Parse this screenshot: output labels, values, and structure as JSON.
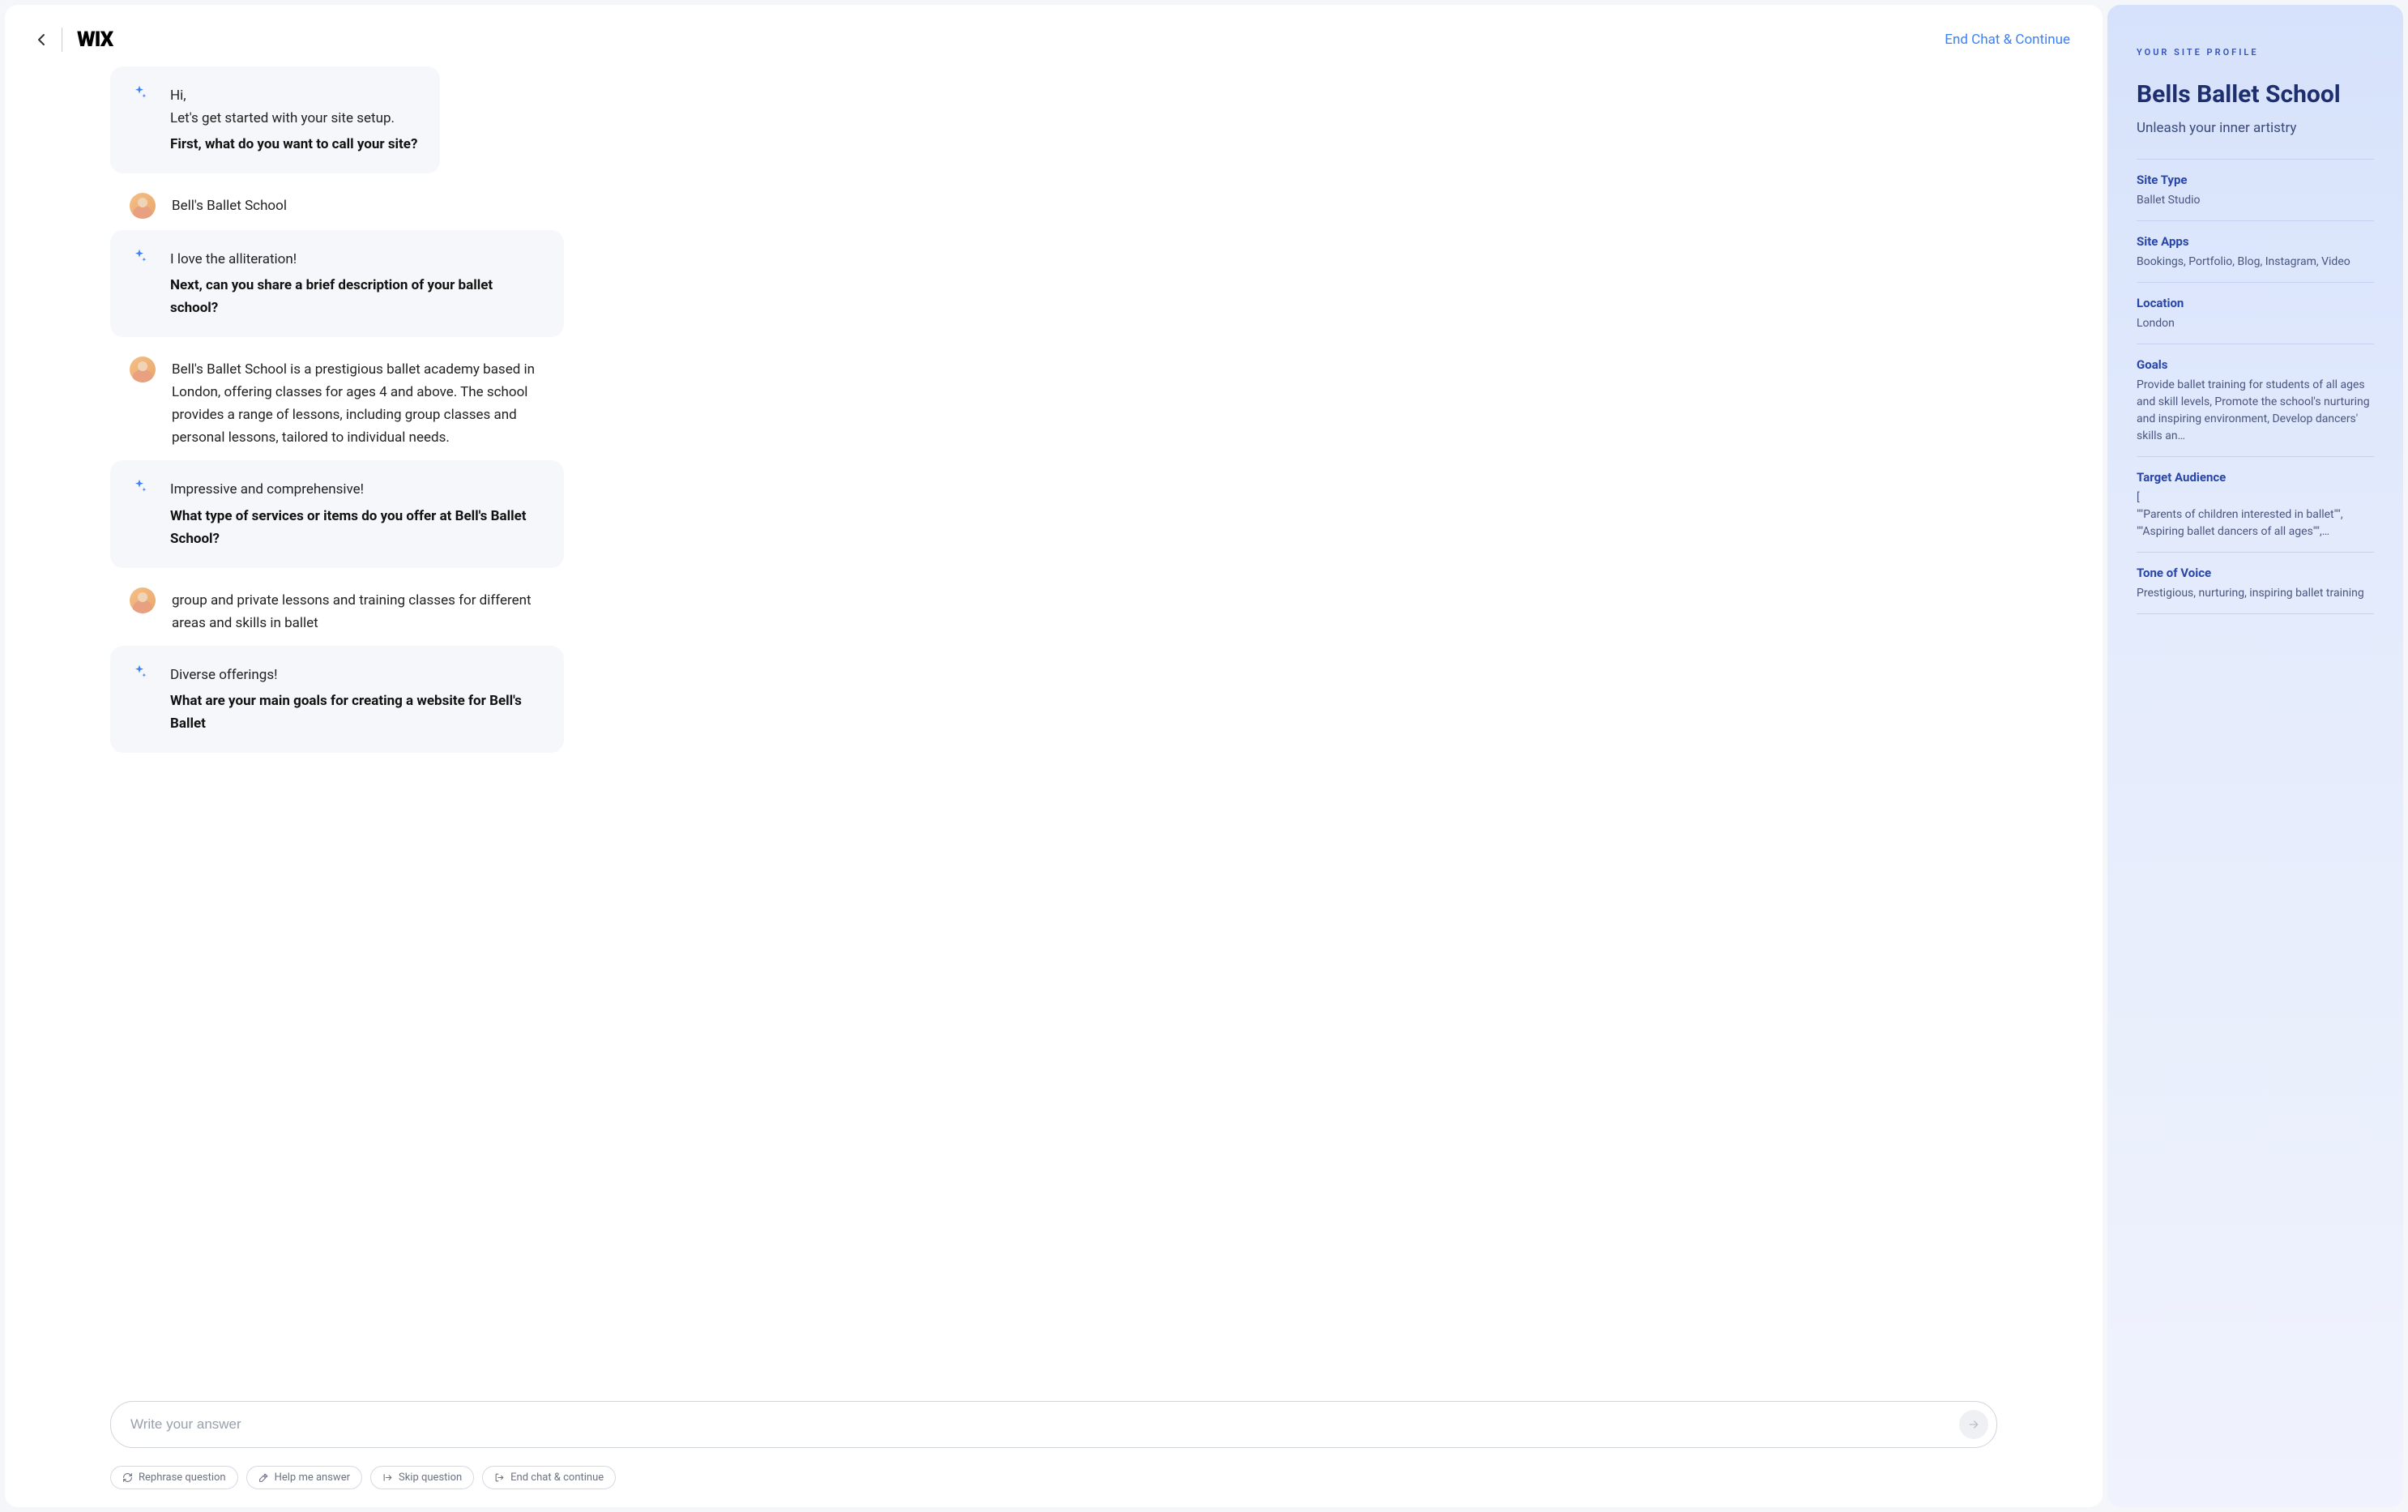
{
  "header": {
    "logo": "WIX",
    "end_chat_link": "End Chat & Continue"
  },
  "chat": [
    {
      "type": "ai",
      "lines": [
        "Hi,",
        "Let's get started with your site setup."
      ],
      "bold": "First, what do you want to call your site?"
    },
    {
      "type": "user",
      "text": "Bell's Ballet School"
    },
    {
      "type": "ai",
      "lines": [
        "I love the alliteration!"
      ],
      "bold": "Next, can you share a brief description of your ballet school?"
    },
    {
      "type": "user",
      "text": "Bell's Ballet School is a prestigious ballet academy based in London, offering classes for ages 4 and above. The school provides a range of lessons, including group classes and personal lessons, tailored to individual needs."
    },
    {
      "type": "ai",
      "lines": [
        "Impressive and comprehensive!"
      ],
      "bold": "What type of services or items do you offer at Bell's Ballet School?"
    },
    {
      "type": "user",
      "text": "group and private lessons and training classes for different areas and skills in ballet"
    },
    {
      "type": "ai",
      "lines": [
        "Diverse offerings!"
      ],
      "bold": "What are your main goals for creating a website for Bell's Ballet"
    }
  ],
  "input": {
    "placeholder": "Write your answer"
  },
  "pills": {
    "rephrase": "Rephrase question",
    "help": "Help me answer",
    "skip": "Skip question",
    "end": "End chat & continue"
  },
  "profile": {
    "label": "YOUR SITE PROFILE",
    "title": "Bells Ballet School",
    "tagline": "Unleash your inner artistry",
    "sections": [
      {
        "label": "Site Type",
        "value": "Ballet Studio"
      },
      {
        "label": "Site Apps",
        "value": "Bookings, Portfolio, Blog, Instagram, Video"
      },
      {
        "label": "Location",
        "value": "London"
      },
      {
        "label": "Goals",
        "value": "Provide ballet training for students of all ages and skill levels, Promote the school's nurturing and inspiring environment, Develop dancers' skills an…"
      },
      {
        "label": "Target Audience",
        "value": "[\n\"\"Parents of children interested in ballet\"\",\n\"\"Aspiring ballet dancers of all ages\"\",…"
      },
      {
        "label": "Tone of Voice",
        "value": "Prestigious, nurturing, inspiring ballet training"
      }
    ]
  }
}
